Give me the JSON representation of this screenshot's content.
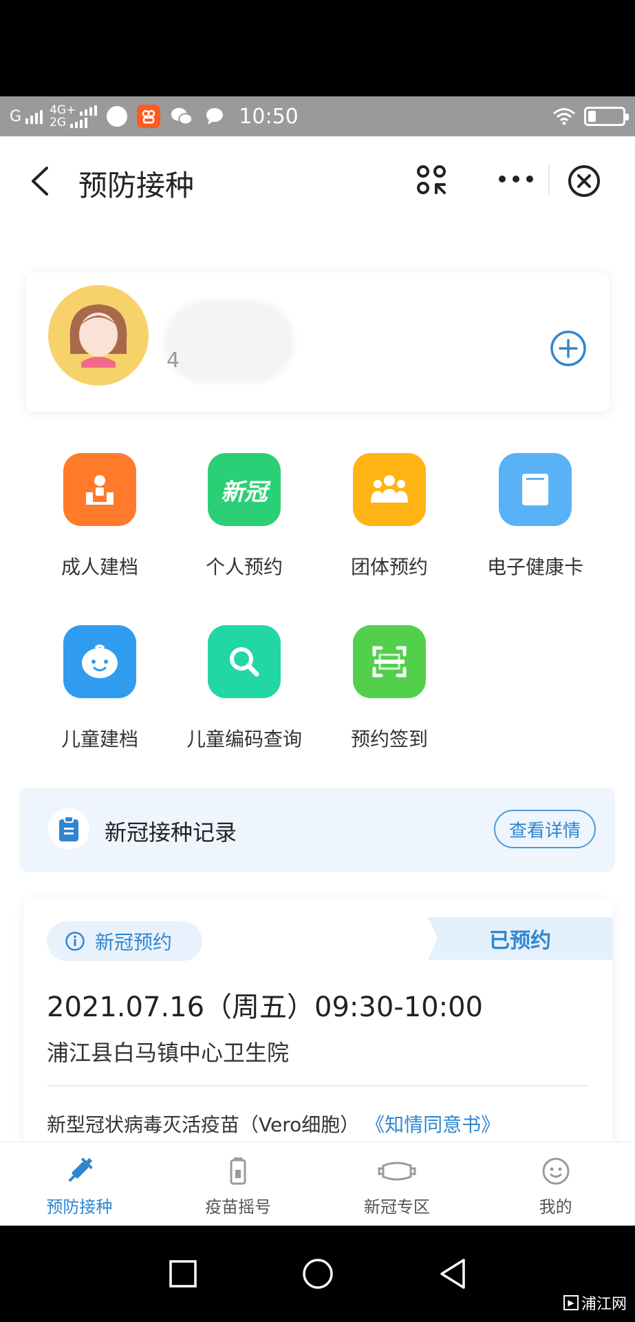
{
  "status_bar": {
    "signal1": "G",
    "net_top": "4G+",
    "net_bottom": "2G",
    "time": "10:50"
  },
  "nav": {
    "title": "预防接种"
  },
  "profile": {
    "sub": "4"
  },
  "grid": [
    {
      "label": "成人建档",
      "color": "#ff7a2a",
      "icon": "adult-record-icon"
    },
    {
      "label": "个人预约",
      "color": "#2bcf75",
      "icon": "covid-icon",
      "icon_text": "新冠"
    },
    {
      "label": "团体预约",
      "color": "#ffb414",
      "icon": "group-icon"
    },
    {
      "label": "电子健康卡",
      "color": "#58b2f5",
      "icon": "health-card-icon"
    },
    {
      "label": "儿童建档",
      "color": "#2f9cf0",
      "icon": "child-face-icon"
    },
    {
      "label": "儿童编码查询",
      "color": "#22d6a6",
      "icon": "search-icon"
    },
    {
      "label": "预约签到",
      "color": "#52d04c",
      "icon": "scan-checkin-icon"
    }
  ],
  "record": {
    "label": "新冠接种记录",
    "button": "查看详情"
  },
  "appointment": {
    "tag": "新冠预约",
    "status": "已预约",
    "time": "2021.07.16（周五）09:30-10:00",
    "place": "浦江县白马镇中心卫生院",
    "vaccine": "新型冠状病毒灭活疫苗（Vero细胞）",
    "consent_link": "《知情同意书》"
  },
  "tabs": [
    {
      "label": "预防接种",
      "active": true
    },
    {
      "label": "疫苗摇号",
      "active": false
    },
    {
      "label": "新冠专区",
      "active": false
    },
    {
      "label": "我的",
      "active": false
    }
  ],
  "watermark": "浦江网",
  "colors": {
    "accent": "#2f86cf"
  }
}
